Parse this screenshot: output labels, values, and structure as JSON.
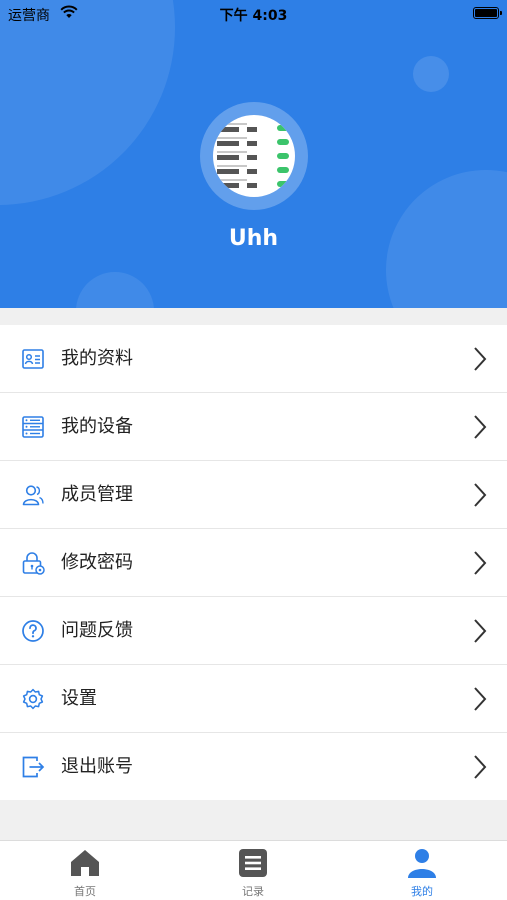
{
  "status_bar": {
    "carrier": "运营商",
    "time": "下午 4:03"
  },
  "profile": {
    "username": "Uhh"
  },
  "menu": [
    {
      "label": "我的资料",
      "icon": "profile-card-icon"
    },
    {
      "label": "我的设备",
      "icon": "device-list-icon"
    },
    {
      "label": "成员管理",
      "icon": "members-icon"
    },
    {
      "label": "修改密码",
      "icon": "lock-gear-icon"
    },
    {
      "label": "问题反馈",
      "icon": "question-icon"
    },
    {
      "label": "设置",
      "icon": "settings-gear-icon"
    },
    {
      "label": "退出账号",
      "icon": "logout-icon"
    }
  ],
  "tabbar": {
    "items": [
      {
        "label": "首页",
        "icon": "home-icon"
      },
      {
        "label": "记录",
        "icon": "records-icon"
      },
      {
        "label": "我的",
        "icon": "user-icon"
      }
    ],
    "active": "我的"
  },
  "colors": {
    "primary": "#2e7fe6",
    "background": "#f0f0f0",
    "tab_inactive": "#777777"
  }
}
